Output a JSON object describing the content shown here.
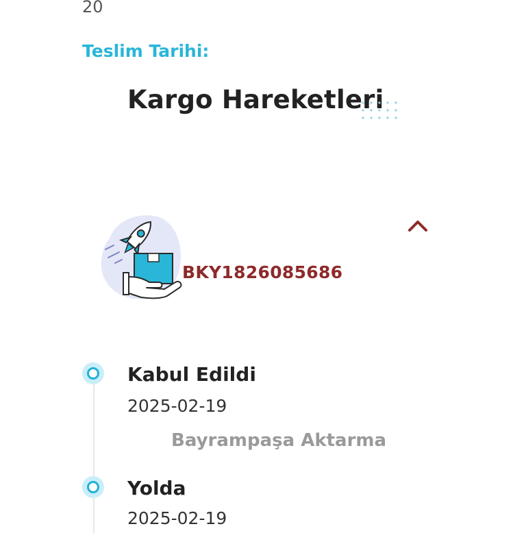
{
  "header": {
    "partial_number": "20",
    "delivery_date_label": "Teslim Tarihi:"
  },
  "section": {
    "title": "Kargo Hareketleri"
  },
  "shipment": {
    "tracking_code": "BKY1826085686",
    "illustration_icon": "rocket-box-hand-icon",
    "toggle_icon": "chevron-up-icon"
  },
  "timeline": [
    {
      "status": "Kabul Edildi",
      "date": "2025-02-19",
      "location": "Bayrampaşa Aktarma"
    },
    {
      "status": "Yolda",
      "date": "2025-02-19"
    }
  ],
  "colors": {
    "accent_blue": "#29b6d8",
    "tracking_red": "#8e2a2a",
    "dot_fill": "#c9eef8",
    "dot_ring": "#1fb1d9"
  }
}
